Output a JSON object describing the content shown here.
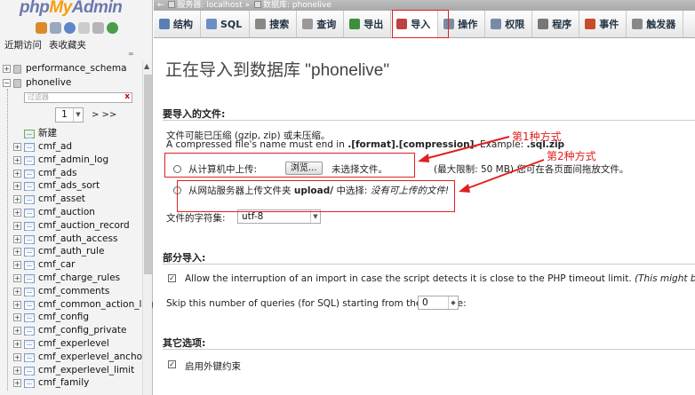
{
  "logo": {
    "php": "php",
    "my": "My",
    "admin": "Admin"
  },
  "nav": {
    "tabs": [
      "近期访问",
      "表收藏夹"
    ],
    "databases": [
      {
        "name": "performance_schema"
      },
      {
        "name": "phonelive"
      }
    ],
    "filter_placeholder": "过滤器",
    "filter_clear": "x",
    "page_value": "1",
    "page_next": "> >>",
    "new_label": "新建",
    "tables": [
      "cmf_ad",
      "cmf_admin_log",
      "cmf_ads",
      "cmf_ads_sort",
      "cmf_asset",
      "cmf_auction",
      "cmf_auction_record",
      "cmf_auth_access",
      "cmf_auth_rule",
      "cmf_car",
      "cmf_charge_rules",
      "cmf_comments",
      "cmf_common_action_log",
      "cmf_config",
      "cmf_config_private",
      "cmf_experlevel",
      "cmf_experlevel_anchor",
      "cmf_experlevel_limit",
      "cmf_family"
    ]
  },
  "breadcrumb": {
    "server": "服务器: localhost »",
    "db": "数据库: phonelive"
  },
  "topmenu": [
    {
      "label": "结构",
      "icon": "structure-icon",
      "color": "#5b7fb5"
    },
    {
      "label": "SQL",
      "icon": "sql-icon",
      "color": "#6a8fc6"
    },
    {
      "label": "搜索",
      "icon": "search-icon",
      "color": "#888"
    },
    {
      "label": "查询",
      "icon": "query-icon",
      "color": "#999"
    },
    {
      "label": "导出",
      "icon": "export-icon",
      "color": "#3c8f3c"
    },
    {
      "label": "导入",
      "icon": "import-icon",
      "color": "#c04040"
    },
    {
      "label": "操作",
      "icon": "operations-icon",
      "color": "#7d8aa0"
    },
    {
      "label": "权限",
      "icon": "privileges-icon",
      "color": "#7a8aa5"
    },
    {
      "label": "程序",
      "icon": "routines-icon",
      "color": "#777"
    },
    {
      "label": "事件",
      "icon": "events-icon",
      "color": "#c84a2a"
    },
    {
      "label": "触发器",
      "icon": "triggers-icon",
      "color": "#888"
    }
  ],
  "page_title": "正在导入到数据库 \"phonelive\"",
  "file_section": {
    "heading": "要导入的文件:",
    "compress_note": "文件可能已压缩 (gzip, zip) 或未压缩。",
    "name_note_prefix": "A compressed file's name must end in ",
    "name_note_format": ".[format].[compression]",
    "name_note_example_prefix": ". Example: ",
    "name_note_example": ".sql.zip",
    "upload_local_label": "从计算机中上传:",
    "browse_button": "浏览...",
    "no_file": "未选择文件。",
    "max_limit": "(最大限制: 50 MB) 您可在各页面间拖放文件。",
    "upload_server_label": "从网站服务器上传文件夹",
    "upload_dir": "upload/",
    "upload_server_mid": "中选择:",
    "no_files_available": "没有可上传的文件!",
    "charset_label": "文件的字符集:",
    "charset_value": "utf-8"
  },
  "annotations": {
    "first": "第1种方式",
    "second": "第2种方式"
  },
  "partial_section": {
    "heading": "部分导入:",
    "allow_interrupt": "Allow the interruption of an import in case the script detects it is close to the PHP timeout limit.",
    "allow_interrupt_note": "(This might be a good way to import la",
    "skip_label": "Skip this number of queries (for SQL) starting from the first one:",
    "skip_value": "0"
  },
  "other_section": {
    "heading": "其它选项:",
    "foreign_keys": "启用外键约束"
  },
  "colors": {
    "annotation_red": "#e02020",
    "logo_blue": "#6c78af",
    "logo_orange": "#f89c0e"
  }
}
